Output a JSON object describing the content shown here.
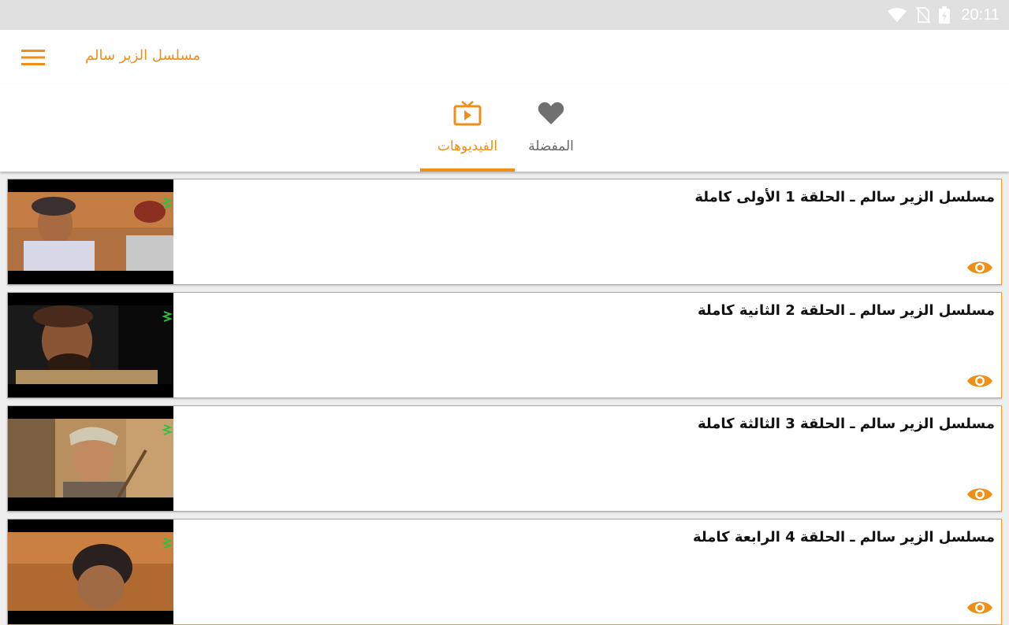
{
  "status_bar": {
    "time": "20:11",
    "icons": [
      "wifi-icon",
      "no-sim-icon",
      "battery-charging-icon"
    ]
  },
  "app_bar": {
    "title": "مسلسل الزير سالم",
    "menu_icon": "hamburger-menu-icon"
  },
  "tabs": [
    {
      "label": "الفيديوهات",
      "icon": "tv-play-icon",
      "selected": true
    },
    {
      "label": "المفضلة",
      "icon": "heart-icon",
      "selected": false
    }
  ],
  "colors": {
    "accent": "#ef8f17",
    "status_bar": "#e0e0e0",
    "background": "#eeeeee",
    "inactive": "#666666"
  },
  "videos": [
    {
      "title": "مسلسل الزير سالم ـ الحلقة 1 الأولى كاملة",
      "icon": "eye-icon"
    },
    {
      "title": "مسلسل الزير سالم ـ الحلقة 2 الثانية كاملة",
      "icon": "eye-icon"
    },
    {
      "title": "مسلسل الزير سالم ـ الحلقة 3 الثالثة كاملة",
      "icon": "eye-icon"
    },
    {
      "title": "مسلسل الزير سالم ـ الحلقة 4 الرابعة كاملة",
      "icon": "eye-icon"
    }
  ]
}
